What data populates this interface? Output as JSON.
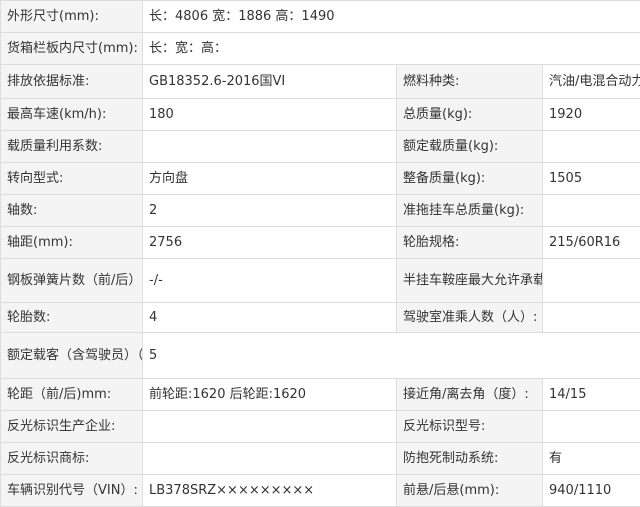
{
  "rows": [
    {
      "label": "外形尺寸(mm):",
      "value": "长：4806 宽：1886 高：1490"
    },
    {
      "label": "货箱栏板内尺寸(mm):",
      "value": "长：宽：高："
    },
    {
      "label": "排放依据标准:",
      "value": "GB18352.6-2016国VI",
      "label2": "燃料种类:",
      "value2": "汽油/电混合动力"
    },
    {
      "label": "最高车速(km/h):",
      "value": "180",
      "label2": "总质量(kg):",
      "value2": "1920"
    },
    {
      "label": "载质量利用系数:",
      "value": "",
      "label2": "额定载质量(kg):",
      "value2": ""
    },
    {
      "label": "转向型式:",
      "value": "方向盘",
      "label2": "整备质量(kg):",
      "value2": "1505"
    },
    {
      "label": "轴数:",
      "value": "2",
      "label2": "准拖挂车总质量(kg):",
      "value2": ""
    },
    {
      "label": "轴距(mm):",
      "value": "2756",
      "label2": "轮胎规格:",
      "value2": "215/60R16"
    },
    {
      "label": "钢板弹簧片数（前/后）:",
      "value": "-/-",
      "label2": "半挂车鞍座最大允许承载质量(kg):",
      "value2": ""
    },
    {
      "label": "轮胎数:",
      "value": "4",
      "label2": "驾驶室准乘人数（人）:",
      "value2": ""
    },
    {
      "label": "额定载客（含驾驶员）（座位数）:",
      "value": "5"
    },
    {
      "label": "轮距（前/后)mm:",
      "value": "前轮距:1620 后轮距:1620",
      "label2": "接近角/离去角（度）:",
      "value2": "14/15"
    },
    {
      "label": "反光标识生产企业:",
      "value": "",
      "label2": "反光标识型号:",
      "value2": ""
    },
    {
      "label": "反光标识商标:",
      "value": "",
      "label2": "防抱死制动系统:",
      "value2": "有"
    },
    {
      "label": "车辆识别代号（VIN）:",
      "value": "LB378SRZ×××××××××",
      "label2": "前悬/后悬(mm):",
      "value2": "940/1110"
    }
  ]
}
